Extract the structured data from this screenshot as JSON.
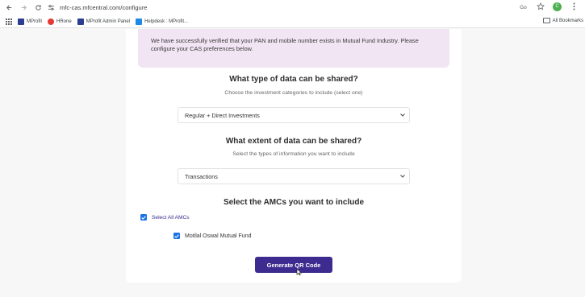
{
  "browser": {
    "url": "mfc-cas.mfcentral.com/configure",
    "bookmarks": [
      {
        "label": "MProfit",
        "color": "#2a3d8f"
      },
      {
        "label": "HRone",
        "color": "#e53935"
      },
      {
        "label": "MProfit Admin Panel",
        "color": "#2a3d8f"
      },
      {
        "label": "Helpdesk : MProfit...",
        "color": "#1e88e5"
      }
    ],
    "all_bookmarks_label": "All Bookmarks",
    "profile_initial": "C"
  },
  "notice": {
    "text": "We have successfully verified that your PAN and mobile number exists in Mutual Fund Industry. Please configure your CAS preferences below."
  },
  "data_type": {
    "title": "What type of data can be shared?",
    "subtitle": "Choose the investment categories to include (select one)",
    "selected": "Regular + Direct Investments"
  },
  "data_extent": {
    "title": "What extent of data can be shared?",
    "subtitle": "Select the types of information you want to include",
    "selected": "Transactions"
  },
  "amcs": {
    "title": "Select the AMCs you want to include",
    "select_all_label": "Select All AMCs",
    "select_all_checked": true,
    "items": [
      {
        "label": "Motilal Oswal Mutual Fund",
        "checked": true
      }
    ]
  },
  "actions": {
    "generate_label": "Generate QR Code"
  },
  "colors": {
    "accent": "#3d2b8f",
    "checkbox": "#1a73e8",
    "notice_bg": "#f1e5f3"
  }
}
